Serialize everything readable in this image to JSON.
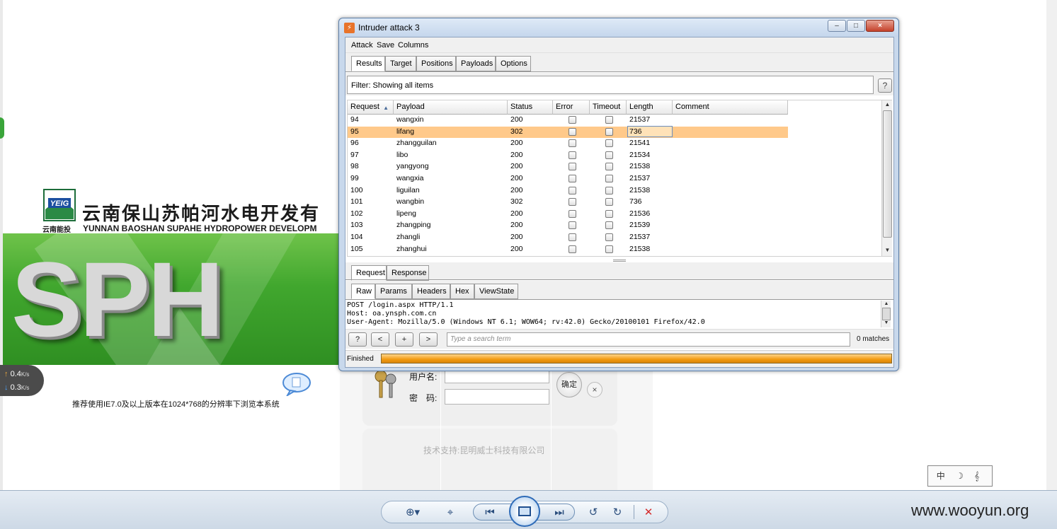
{
  "background_page": {
    "logo_mark": "YEIG",
    "logo_sub": "云南能投",
    "company_cn": "云南保山苏帕河水电开发有",
    "company_en": "YUNNAN BAOSHAN SUPAHE HYDROPOWER DEVELOPM",
    "banner_text": "SPH",
    "recommend": "推荐使用IE7.0及以上版本在1024*768的分辨率下浏览本系统",
    "login": {
      "username_label": "用户名:",
      "password_label": "密　码:",
      "ok_label": "确定",
      "close_label": "×"
    },
    "support": "技术支持:昆明威士科技有限公司",
    "speed_up": "0.4",
    "speed_down": "0.3",
    "speed_unit": "K/s",
    "ime": "中 ☽ 𝄞"
  },
  "intruder": {
    "title": "Intruder attack 3",
    "window_controls": {
      "minimize": "–",
      "maximize": "□",
      "close": "×"
    },
    "menu": [
      "Attack",
      "Save",
      "Columns"
    ],
    "tabs": [
      "Results",
      "Target",
      "Positions",
      "Payloads",
      "Options"
    ],
    "filter": "Filter: Showing all items",
    "help": "?",
    "columns": [
      "Request",
      "Payload",
      "Status",
      "Error",
      "Timeout",
      "Length",
      "Comment"
    ],
    "sort_indicator": "▲",
    "rows": [
      {
        "request": "94",
        "payload": "wangxin",
        "status": "200",
        "length": "21537"
      },
      {
        "request": "95",
        "payload": "lifang",
        "status": "302",
        "length": "736"
      },
      {
        "request": "96",
        "payload": "zhangguilan",
        "status": "200",
        "length": "21541"
      },
      {
        "request": "97",
        "payload": "libo",
        "status": "200",
        "length": "21534"
      },
      {
        "request": "98",
        "payload": "yangyong",
        "status": "200",
        "length": "21538"
      },
      {
        "request": "99",
        "payload": "wangxia",
        "status": "200",
        "length": "21537"
      },
      {
        "request": "100",
        "payload": "liguilan",
        "status": "200",
        "length": "21538"
      },
      {
        "request": "101",
        "payload": "wangbin",
        "status": "302",
        "length": "736"
      },
      {
        "request": "102",
        "payload": "lipeng",
        "status": "200",
        "length": "21536"
      },
      {
        "request": "103",
        "payload": "zhangping",
        "status": "200",
        "length": "21539"
      },
      {
        "request": "104",
        "payload": "zhangli",
        "status": "200",
        "length": "21537"
      },
      {
        "request": "105",
        "payload": "zhanghui",
        "status": "200",
        "length": "21538"
      }
    ],
    "selected_row": "95",
    "req_tabs": [
      "Request",
      "Response"
    ],
    "sub_tabs": [
      "Raw",
      "Params",
      "Headers",
      "Hex",
      "ViewState"
    ],
    "raw_lines": [
      "POST /login.aspx HTTP/1.1",
      "Host: oa.ynsph.com.cn",
      "User-Agent: Mozilla/5.0 (Windows NT 6.1; WOW64; rv:42.0) Gecko/20100101 Firefox/42.0"
    ],
    "search_buttons": [
      "?",
      "<",
      "+",
      ">"
    ],
    "search_placeholder": "Type a search term",
    "matches": "0 matches",
    "status": "Finished",
    "progress": 1.0
  },
  "viewer": {
    "watermark": "www.wooyun.org"
  },
  "colors": {
    "selected_row": "#ffc98a",
    "progress": "#f29a10",
    "banner_green": "#41a72e"
  }
}
